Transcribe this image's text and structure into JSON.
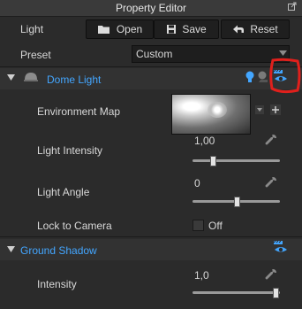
{
  "window": {
    "title": "Property Editor"
  },
  "toolbar": {
    "light_label": "Light",
    "open_label": "Open",
    "save_label": "Save",
    "reset_label": "Reset"
  },
  "preset": {
    "label": "Preset",
    "value": "Custom"
  },
  "dome_light": {
    "title": "Dome Light",
    "environment_map_label": "Environment Map",
    "intensity": {
      "label": "Light Intensity",
      "value": "1,00",
      "fraction": 0.22
    },
    "angle": {
      "label": "Light Angle",
      "value": "0",
      "fraction": 0.5
    },
    "lock_to_camera": {
      "label": "Lock to Camera",
      "value": "Off"
    }
  },
  "ground_shadow": {
    "title": "Ground Shadow",
    "intensity": {
      "label": "Intensity",
      "value": "1,0",
      "fraction": 0.98
    }
  },
  "colors": {
    "accent": "#43a6ff",
    "highlight": "#e0201c"
  }
}
